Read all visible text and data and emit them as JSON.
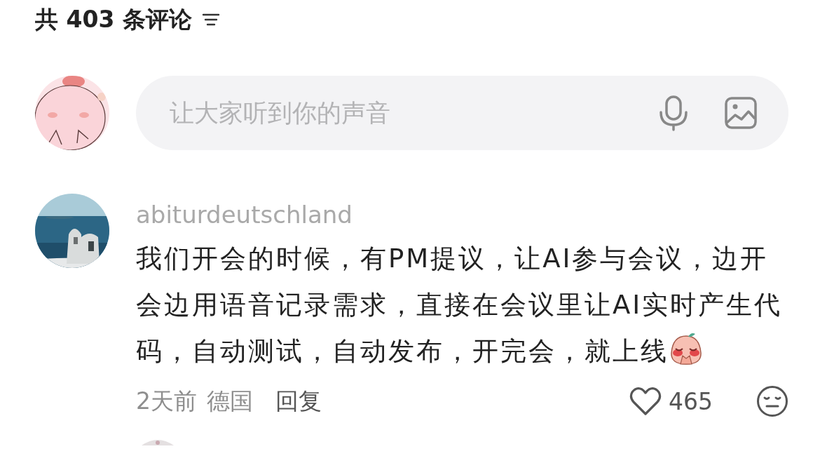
{
  "header": {
    "title": "共 403 条评论"
  },
  "composer": {
    "placeholder": "让大家听到你的声音"
  },
  "comments": [
    {
      "username": "abiturdeutschland",
      "text": "我们开会的时候，有PM提议，让AI参与会议，边开会边用语音记录需求，直接在会议里让AI实时产生代码，自动测试，自动发布，开完会，就上线",
      "time": "2天前",
      "location": "德国",
      "reply": "回复",
      "likes": "465",
      "liked": false
    }
  ]
}
